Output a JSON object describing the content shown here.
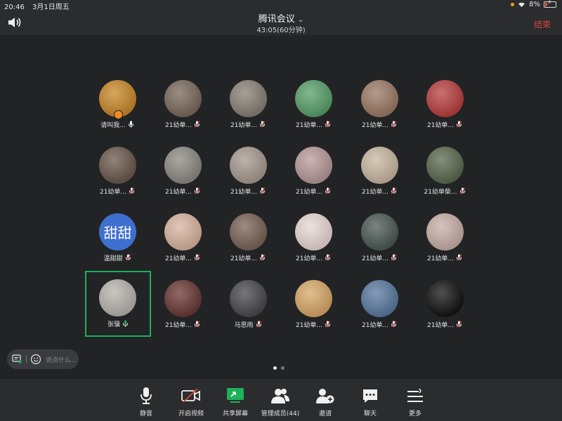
{
  "status_bar": {
    "time": "20:46",
    "date": "3月1日周五",
    "battery": "8%"
  },
  "header": {
    "title": "腾讯会议",
    "timer": "43:05(60分钟)",
    "end_label": "结束"
  },
  "participants": [
    {
      "name": "请叫我...",
      "mic": "on",
      "color": "#c8892a",
      "host": true
    },
    {
      "name": "21幼单...",
      "mic": "off",
      "color": "#7a6a5d"
    },
    {
      "name": "21幼单...",
      "mic": "off",
      "color": "#8a8176"
    },
    {
      "name": "21幼单...",
      "mic": "off",
      "color": "#5aa06a"
    },
    {
      "name": "21幼单...",
      "mic": "off",
      "color": "#9c7b66"
    },
    {
      "name": "21幼单...",
      "mic": "off",
      "color": "#b94040"
    },
    {
      "name": "21幼单...",
      "mic": "off",
      "color": "#6b5a4e"
    },
    {
      "name": "21幼单...",
      "mic": "off",
      "color": "#8e8a84"
    },
    {
      "name": "21幼单...",
      "mic": "off",
      "color": "#a89a90"
    },
    {
      "name": "21幼单...",
      "mic": "off",
      "color": "#b89a9a"
    },
    {
      "name": "21幼单...",
      "mic": "off",
      "color": "#c9b8a2"
    },
    {
      "name": "21幼单柴...",
      "mic": "off",
      "color": "#5c6a50"
    },
    {
      "name": "温甜甜",
      "mic": "off",
      "color": "#3f6fcf",
      "text": "甜甜"
    },
    {
      "name": "21幼单...",
      "mic": "off",
      "color": "#d9b4a0"
    },
    {
      "name": "21幼单...",
      "mic": "off",
      "color": "#7a6458"
    },
    {
      "name": "21幼单...",
      "mic": "off",
      "color": "#e8d8d4"
    },
    {
      "name": "21幼单...",
      "mic": "off",
      "color": "#4e5a56"
    },
    {
      "name": "21幼单...",
      "mic": "off",
      "color": "#c8b0a8"
    },
    {
      "name": "张骥",
      "mic": "on",
      "color": "#b8b4ae",
      "active": true
    },
    {
      "name": "21幼单...",
      "mic": "off",
      "color": "#6a3a36"
    },
    {
      "name": "马思雨",
      "mic": "off",
      "color": "#4a4a4e"
    },
    {
      "name": "21幼单...",
      "mic": "off",
      "color": "#d8a868"
    },
    {
      "name": "21幼单...",
      "mic": "off",
      "color": "#5a7aa0"
    },
    {
      "name": "21幼单...",
      "mic": "off",
      "color": "#151515"
    }
  ],
  "chat_input": {
    "placeholder": "说点什么..."
  },
  "toolbar": {
    "mute": "静音",
    "video": "开启视频",
    "share": "共享屏幕",
    "members": "管理成员(44)",
    "invite": "邀请",
    "chat": "聊天",
    "more": "更多"
  }
}
